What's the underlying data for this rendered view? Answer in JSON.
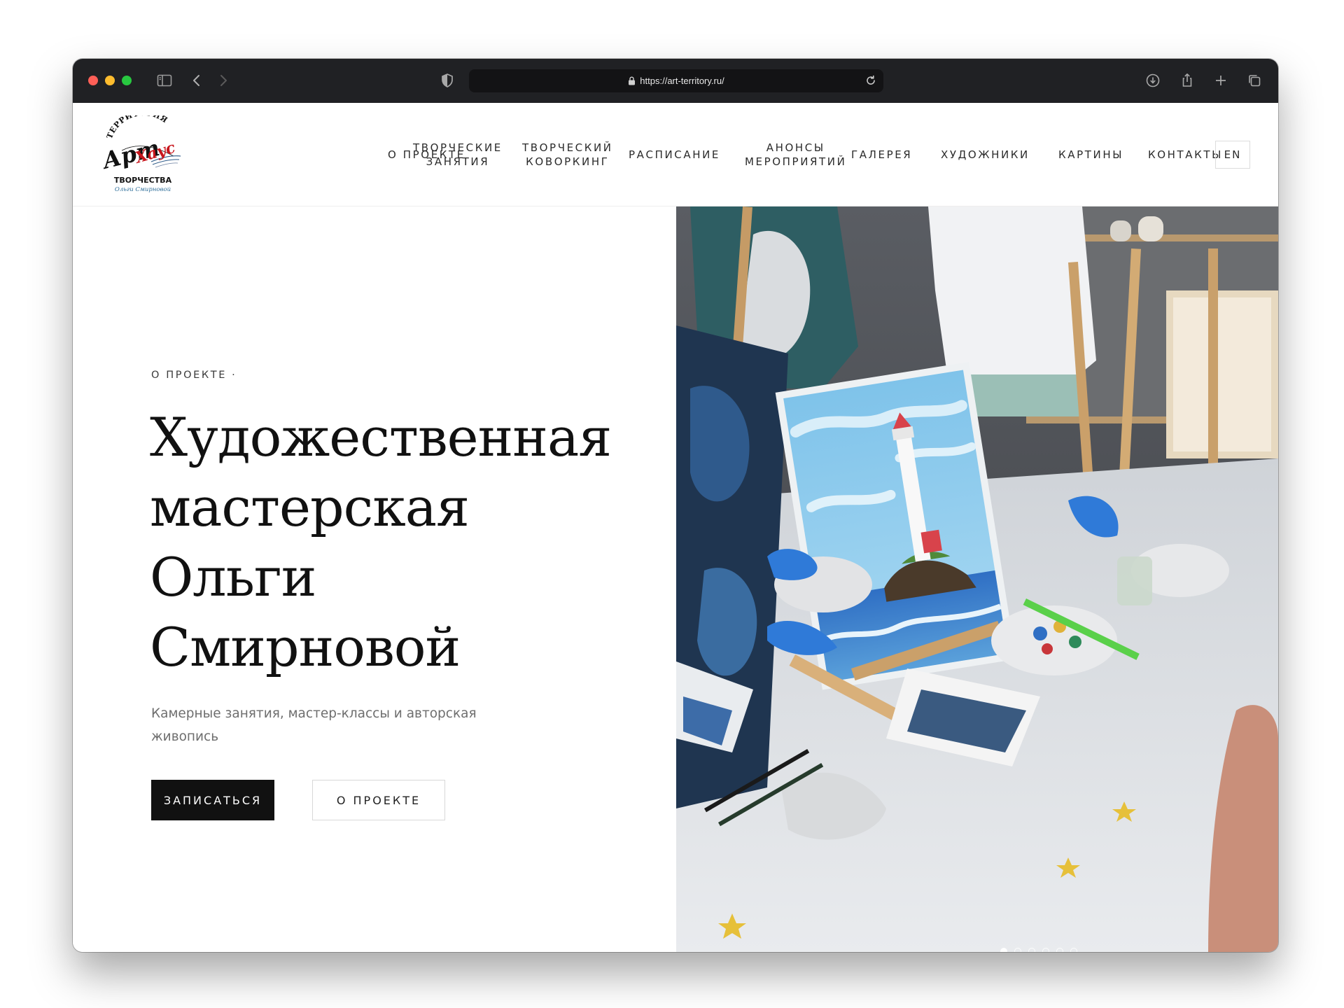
{
  "browser": {
    "url": "https://art-territory.ru/",
    "colors": {
      "chrome": "#202124",
      "address_bar": "#131315"
    }
  },
  "logo": {
    "top_text": "ТЕРРИТОРИЯ",
    "art_text": "Арт",
    "haus_text": "Хаус",
    "bottom_text": "ТВОРЧЕСТВА",
    "signature_text": "Ольги Смирновой"
  },
  "nav": {
    "items": [
      {
        "line1": "О ПРОЕКТЕ",
        "line2": ""
      },
      {
        "line1": "ТВОРЧЕСКИЕ",
        "line2": "ЗАНЯТИЯ"
      },
      {
        "line1": "ТВОРЧЕСКИЙ",
        "line2": "КОВОРКИНГ"
      },
      {
        "line1": "РАСПИСАНИЕ",
        "line2": ""
      },
      {
        "line1": "АНОНСЫ",
        "line2": "МЕРОПРИЯТИЙ"
      },
      {
        "line1": "ГАЛЕРЕЯ",
        "line2": ""
      },
      {
        "line1": "ХУДОЖНИКИ",
        "line2": ""
      },
      {
        "line1": "КАРТИНЫ",
        "line2": ""
      },
      {
        "line1": "КОНТАКТЫ",
        "line2": ""
      }
    ],
    "lang": "EN"
  },
  "hero": {
    "eyebrow": "О ПРОЕКТЕ ·",
    "title_lines": [
      "Художественная",
      "мастерская",
      "Ольги",
      "Смирновой"
    ],
    "subtitle": "Камерные занятия, мастер-классы и авторская живопись",
    "primary_button": "ЗАПИСАТЬСЯ",
    "secondary_button": "О ПРОЕКТЕ",
    "slider_dots": 6,
    "active_dot": 0
  },
  "colors": {
    "accent_dark": "#111111",
    "text_muted": "#6e6e6e",
    "logo_red": "#c8161d"
  }
}
